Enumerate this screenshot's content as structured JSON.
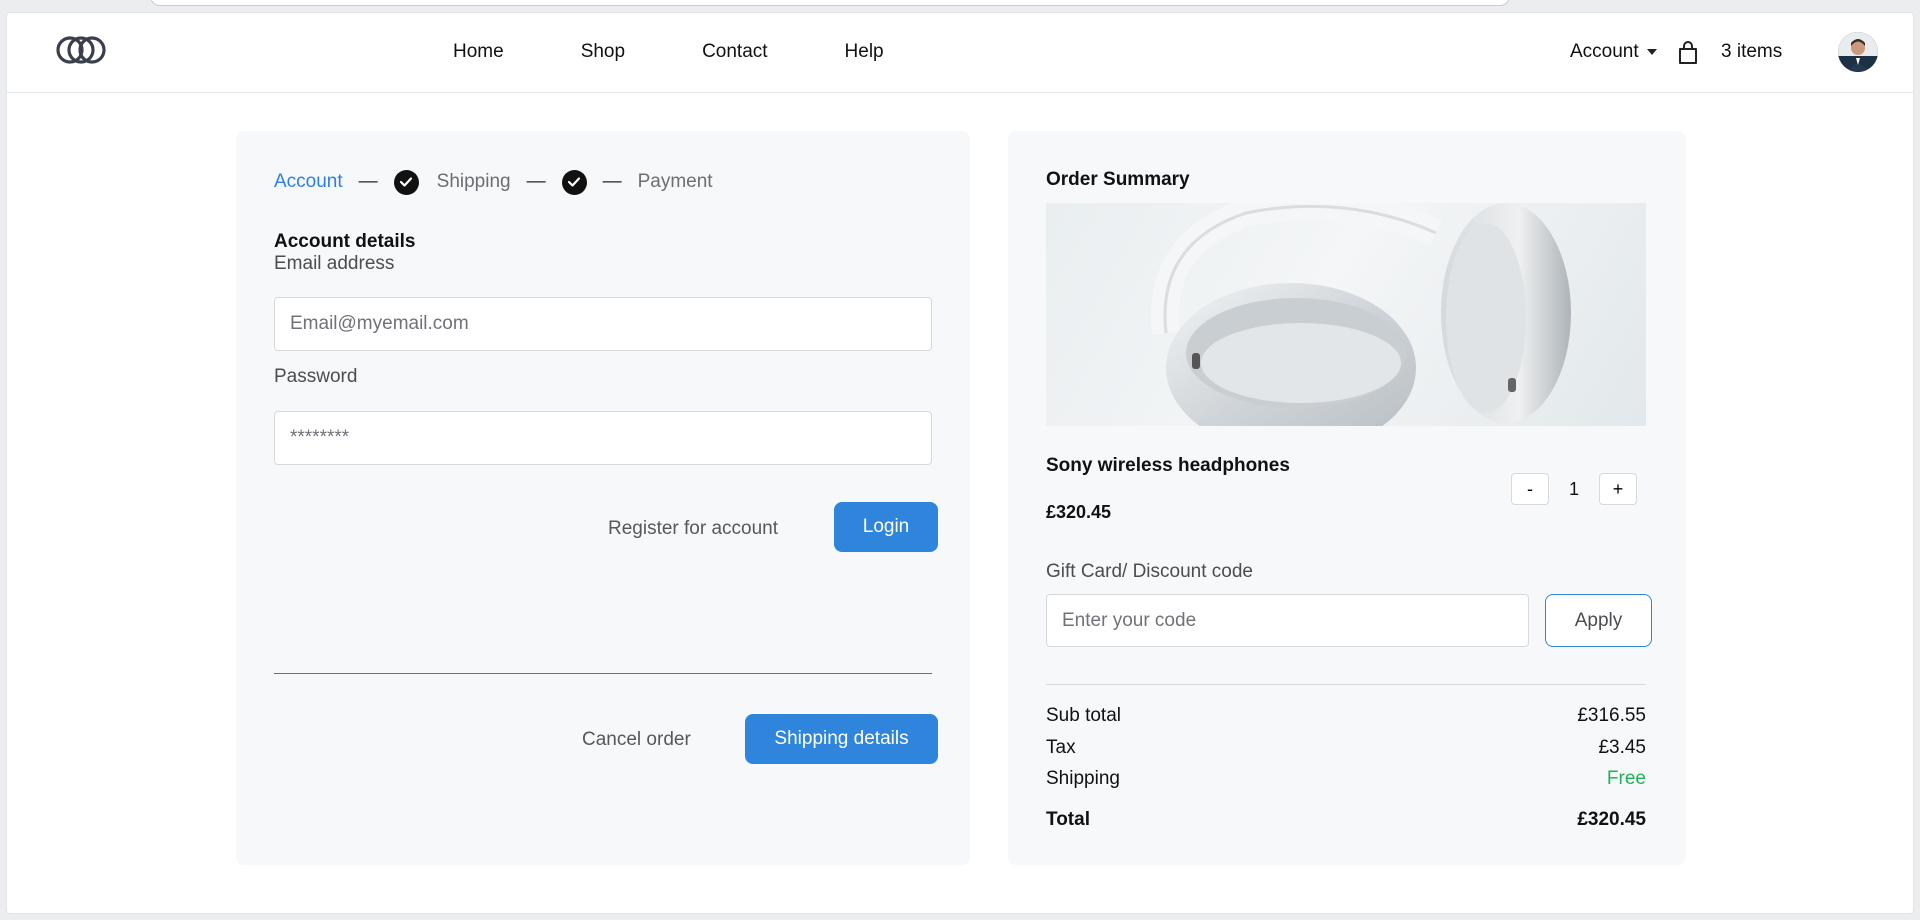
{
  "header": {
    "nav": [
      "Home",
      "Shop",
      "Contact",
      "Help"
    ],
    "account_label": "Account",
    "cart_count": "3 items"
  },
  "checkout": {
    "steps": {
      "account": "Account",
      "shipping": "Shipping",
      "payment": "Payment",
      "dash": "—"
    },
    "section_title": "Account details",
    "email_label": "Email address",
    "email_placeholder": "Email@myemail.com",
    "password_label": "Password",
    "password_placeholder": "********",
    "register_label": "Register for account",
    "login_label": "Login",
    "cancel_label": "Cancel order",
    "shipping_btn_label": "Shipping details"
  },
  "order": {
    "title": "Order Summary",
    "product_name": "Sony wireless headphones",
    "product_price": "£320.45",
    "quantity": "1",
    "qty_minus": "-",
    "qty_plus": "+",
    "code_label": "Gift Card/ Discount code",
    "code_placeholder": "Enter your code",
    "apply_label": "Apply",
    "summary": {
      "subtotal_label": "Sub total",
      "subtotal_value": "£316.55",
      "tax_label": "Tax",
      "tax_value": "£3.45",
      "shipping_label": "Shipping",
      "shipping_value": "Free",
      "total_label": "Total",
      "total_value": "£320.45"
    }
  },
  "colors": {
    "accent": "#2f84dc",
    "step_active": "#2f80de",
    "free": "#22b35a",
    "panel_bg": "#f7f8fa"
  },
  "icons": [
    "logo-icon",
    "chevron-down-icon",
    "shopping-bag-icon",
    "check-icon",
    "avatar"
  ]
}
